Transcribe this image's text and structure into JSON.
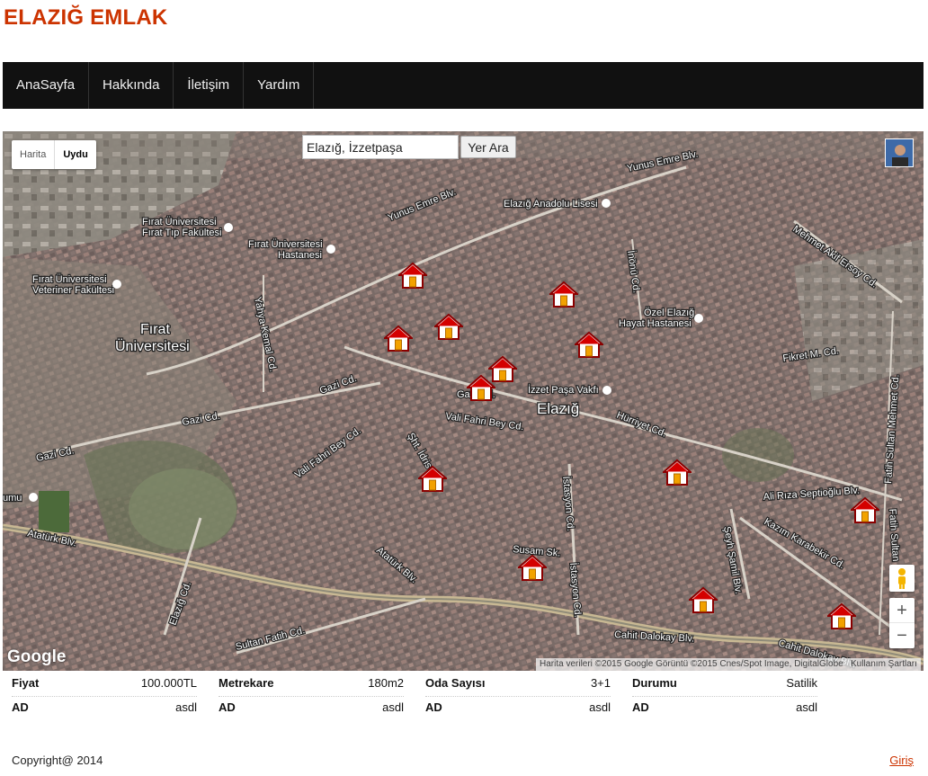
{
  "site": {
    "title": "ELAZIĞ EMLAK"
  },
  "nav": {
    "items": [
      "AnaSayfa",
      "Hakkında",
      "İletişim",
      "Yardım"
    ]
  },
  "map": {
    "type_buttons": {
      "map": "Harita",
      "satellite": "Uydu"
    },
    "active_type": "Uydu",
    "search_value": "Elazığ, İzzetpaşa",
    "search_button": "Yer Ara",
    "google_logo": "Google",
    "attribution": "Harita verileri ©2015 Google Görüntü ©2015 Cnes/Spot Image, DigitalGlobe",
    "terms": "Kullanım Şartları",
    "zoom_in": "+",
    "zoom_out": "−",
    "marker_icon": "house-marker-icon",
    "labels": {
      "yunus_emre_1": "Yunus Emre Blv.",
      "yunus_emre_2": "Yunus Emre Blv.",
      "anadolu_lisesi": "Elazığ Anadolu Lisesi",
      "firat_tip_1": "Fırat Üniversitesi",
      "firat_tip_2": "Fırat Tıp Fakültesi",
      "firat_hastanesi_1": "Fırat Üniversitesi",
      "firat_hastanesi_2": "Hastanesi",
      "veteriner_1": "Fırat Üniversitesi",
      "veteriner_2": "Veteriner Fakültesi",
      "firat_uni_1": "Fırat",
      "firat_uni_2": "Üniversitesi",
      "mehmet_akif": "Mehmet Akif Ersoy Cd.",
      "inonu": "İnönü Cd.",
      "ozel_1": "Özel Elazığ",
      "ozel_2": "Hayat Hastanesi",
      "yahya_kemal": "Yahya Kemal Cd.",
      "fikret": "Fikret M. Cd.",
      "izzet_pasa": "İzzet Paşa Vakfı",
      "elazig": "Elazığ",
      "gazi_1": "Gazi Cd.",
      "gazi_2": "Gazi Cd.",
      "gazi_3": "Gazi Cd.",
      "gazi_4": "Gazi Cd.",
      "vali_fahri_1": "Vali Fahri Bey Cd.",
      "vali_fahri_2": "Vali Fahri Bey Cd.",
      "hurriyet": "Hürriyet Cd.",
      "sht_idris": "Şht. İdris Cd.",
      "istasyon_1": "İstasyon Cd.",
      "istasyon_2": "İstasyon Cd.",
      "ali_riza": "Ali Rıza Septioğlu Blv.",
      "fatih_sultan_1": "Fatih Sultan Mehmet Cd.",
      "fatih_sultan_2": "Fatih Sultan",
      "stadium": "umu",
      "ataturk_1": "Atatürk Blv.",
      "ataturk_2": "Atatürk Blv.",
      "susam": "Susam Sk.",
      "seyh_samil": "Şeyh Şamil Blv.",
      "kazim": "Kazım Karabekir Cd.",
      "elazig_cd": "Elazığ Cd.",
      "sultan_fatih": "Sultan Fatih Cd.",
      "cahit_1": "Cahit Dalokay Blv.",
      "cahit_2": "Cahit Dalokay Blv."
    }
  },
  "listing": {
    "rows": [
      [
        {
          "key": "Fiyat",
          "value": "100.000TL"
        },
        {
          "key": "Metrekare",
          "value": "180m2"
        },
        {
          "key": "Oda Sayısı",
          "value": "3+1"
        },
        {
          "key": "Durumu",
          "value": "Satilik"
        }
      ],
      [
        {
          "key": "AD",
          "value": "asdl"
        },
        {
          "key": "AD",
          "value": "asdl"
        },
        {
          "key": "AD",
          "value": "asdl"
        },
        {
          "key": "AD",
          "value": "asdl"
        }
      ]
    ]
  },
  "footer": {
    "copyright": "Copyright@ 2014",
    "login": "Giriş"
  },
  "colors": {
    "title": "#cc3300",
    "nav_bg": "#111111",
    "link": "#cc3300"
  }
}
